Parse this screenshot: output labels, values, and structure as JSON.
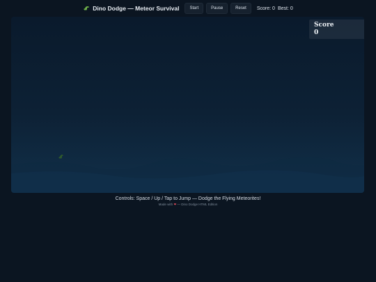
{
  "header": {
    "title": "Dino Dodge — Meteor Survival",
    "buttons": {
      "start": "Start",
      "pause": "Pause",
      "reset": "Reset"
    },
    "score_label": "Score:",
    "score_value": "0",
    "best_label": "Best:",
    "best_value": "0"
  },
  "game": {
    "score_box_label": "Score",
    "score_box_value": "0",
    "player_icon": "dino-icon",
    "sky_color_top": "#0a1a2c",
    "sky_color_bottom": "#11304a"
  },
  "footer": {
    "controls_text": "Controls: Space / Up / Tap to Jump — Dodge the Flying Meteorites!",
    "credit_prefix": "Made with",
    "credit_suffix": "— Dino Dodge HTML Edition",
    "heart": "❤"
  }
}
